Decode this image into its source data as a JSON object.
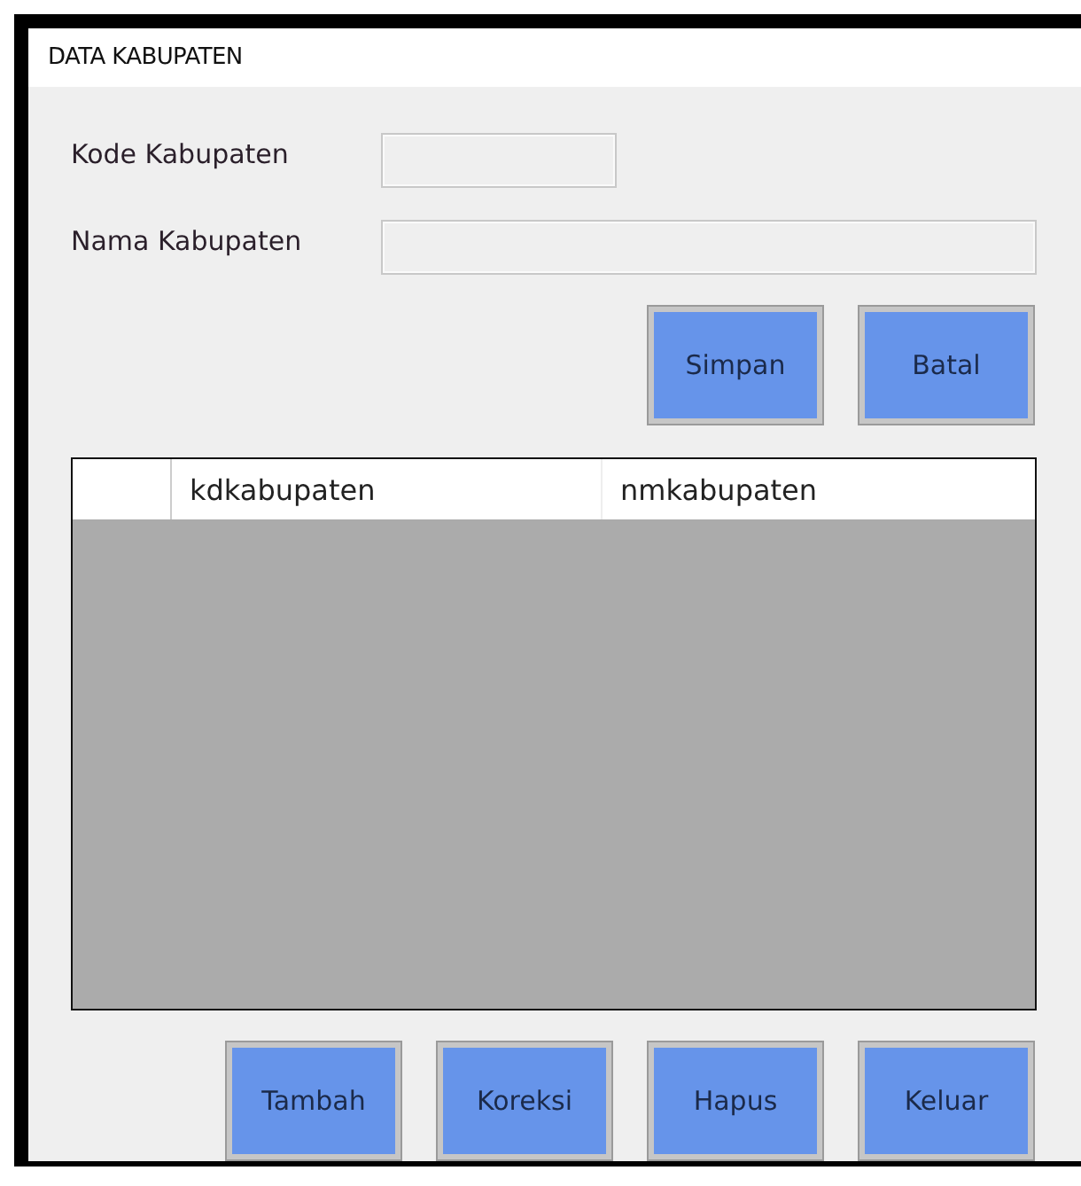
{
  "window": {
    "title": "DATA KABUPATEN"
  },
  "fields": [
    {
      "label": "Kode Kabupaten",
      "kind": "short",
      "disabled": true
    },
    {
      "label": "Nama Kabupaten",
      "kind": "long",
      "disabled": true
    }
  ],
  "form_buttons": [
    "Simpan",
    "Batal"
  ],
  "table": {
    "columns": [
      "kdkabupaten",
      "nmkabupaten"
    ]
  },
  "bottom_buttons": [
    "Tambah",
    "Koreksi",
    "Hapus",
    "Keluar"
  ]
}
